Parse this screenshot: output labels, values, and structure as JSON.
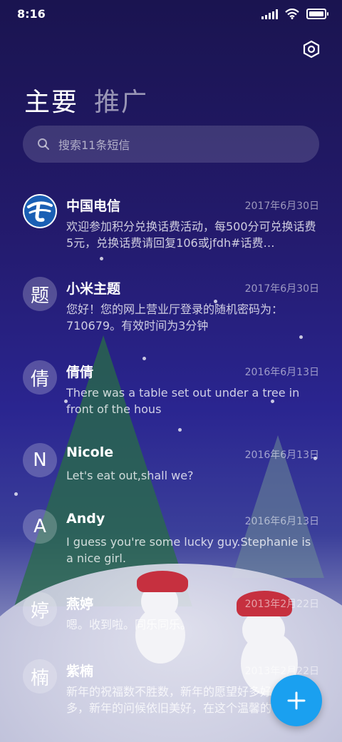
{
  "status": {
    "time": "8:16"
  },
  "tabs": {
    "primary": "主要",
    "promo": "推广"
  },
  "search": {
    "placeholder": "搜索11条短信"
  },
  "messages": [
    {
      "sender": "中国电信",
      "date": "2017年6月30日",
      "preview": "欢迎参加积分兑换话费活动，每500分可兑换话费5元，兑换话费请回复106或jfdh#话费…",
      "avatar": "",
      "avatar_icon": "china-telecom-logo"
    },
    {
      "sender": "小米主题",
      "date": "2017年6月30日",
      "preview": "您好！您的网上营业厅登录的随机密码为：710679。有效时间为3分钟",
      "avatar": "题"
    },
    {
      "sender": "倩倩",
      "date": "2016年6月13日",
      "preview": "There was a table set out under a tree in front of the hous",
      "avatar": "倩"
    },
    {
      "sender": "Nicole",
      "date": "2016年6月13日",
      "preview": "Let's eat out,shall we?",
      "avatar": "N"
    },
    {
      "sender": "Andy",
      "date": "2016年6月13日",
      "preview": "I guess you're some lucky guy.Stephanie is a nice girl.",
      "avatar": "A"
    },
    {
      "sender": "燕婷",
      "date": "2013年2月22日",
      "preview": "嗯。收到啦。同乐同乐。",
      "avatar": "婷"
    },
    {
      "sender": "紫楠",
      "date": "2013年2月22日",
      "preview": "新年的祝福数不胜数，新年的愿望好多好多，新年的问候依旧美好，在这个温馨的时",
      "avatar": "楠"
    }
  ],
  "icons": {
    "settings": "hexagon-settings-icon",
    "search": "search-icon",
    "compose": "plus-icon"
  },
  "colors": {
    "fab": "#1aa0f0",
    "telecom_blue": "#1a5fb4"
  }
}
